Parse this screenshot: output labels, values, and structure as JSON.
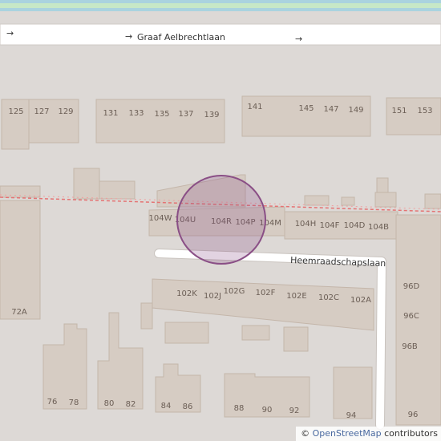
{
  "map": {
    "streets": {
      "main": "Graaf Aelbrechtlaan",
      "side": "Heemraadschapslaan"
    },
    "one_way_arrows": [
      "→",
      "→",
      "→"
    ],
    "marker_color": "#8a4f86",
    "colors": {
      "background": "#ddd9d6",
      "building": "#d6ccc3",
      "road": "#ffffff",
      "water": "#aad3df",
      "grass": "#c7e8c7",
      "boundary": "#e57373"
    },
    "house_numbers": {
      "top_row": [
        "125",
        "127",
        "129",
        "131",
        "133",
        "135",
        "137",
        "139",
        "141",
        "145",
        "147",
        "149",
        "151",
        "153"
      ],
      "middle_row": [
        "104W",
        "104U",
        "104R",
        "104P",
        "104M",
        "104H",
        "104F",
        "104D",
        "104B"
      ],
      "lower_row": [
        "102K",
        "102J",
        "102G",
        "102F",
        "102E",
        "102C",
        "102A"
      ],
      "right_column": [
        "96D",
        "96C",
        "96B",
        "96"
      ],
      "bottom_row": [
        "72A",
        "76",
        "78",
        "80",
        "82",
        "84",
        "86",
        "88",
        "90",
        "92",
        "94"
      ]
    }
  },
  "attribution": {
    "symbol": "©",
    "link_text": "OpenStreetMap",
    "suffix": " contributors"
  }
}
